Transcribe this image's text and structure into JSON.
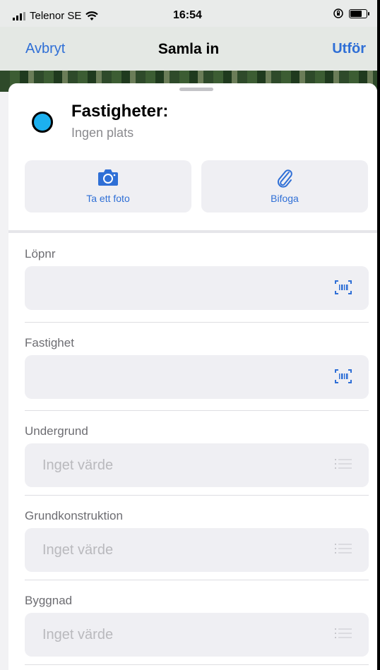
{
  "status_bar": {
    "carrier": "Telenor SE",
    "time": "16:54"
  },
  "nav": {
    "left_label": "Avbryt",
    "title": "Samla in",
    "right_label": "Utför"
  },
  "feature": {
    "title": "Fastigheter:",
    "subtitle": "Ingen plats",
    "dot_color": "#1cb0ef"
  },
  "actions": {
    "photo_label": "Ta ett foto",
    "attach_label": "Bifoga"
  },
  "fields": [
    {
      "label": "Löpnr",
      "value": "",
      "icon": "barcode-scan-icon"
    },
    {
      "label": "Fastighet",
      "value": "",
      "icon": "barcode-scan-icon"
    },
    {
      "label": "Undergrund",
      "placeholder": "Inget värde",
      "icon": "list-icon"
    },
    {
      "label": "Grundkonstruktion",
      "placeholder": "Inget värde",
      "icon": "list-icon"
    },
    {
      "label": "Byggnad",
      "placeholder": "Inget värde",
      "icon": "list-icon"
    }
  ],
  "colors": {
    "accent": "#2f6fd6"
  }
}
